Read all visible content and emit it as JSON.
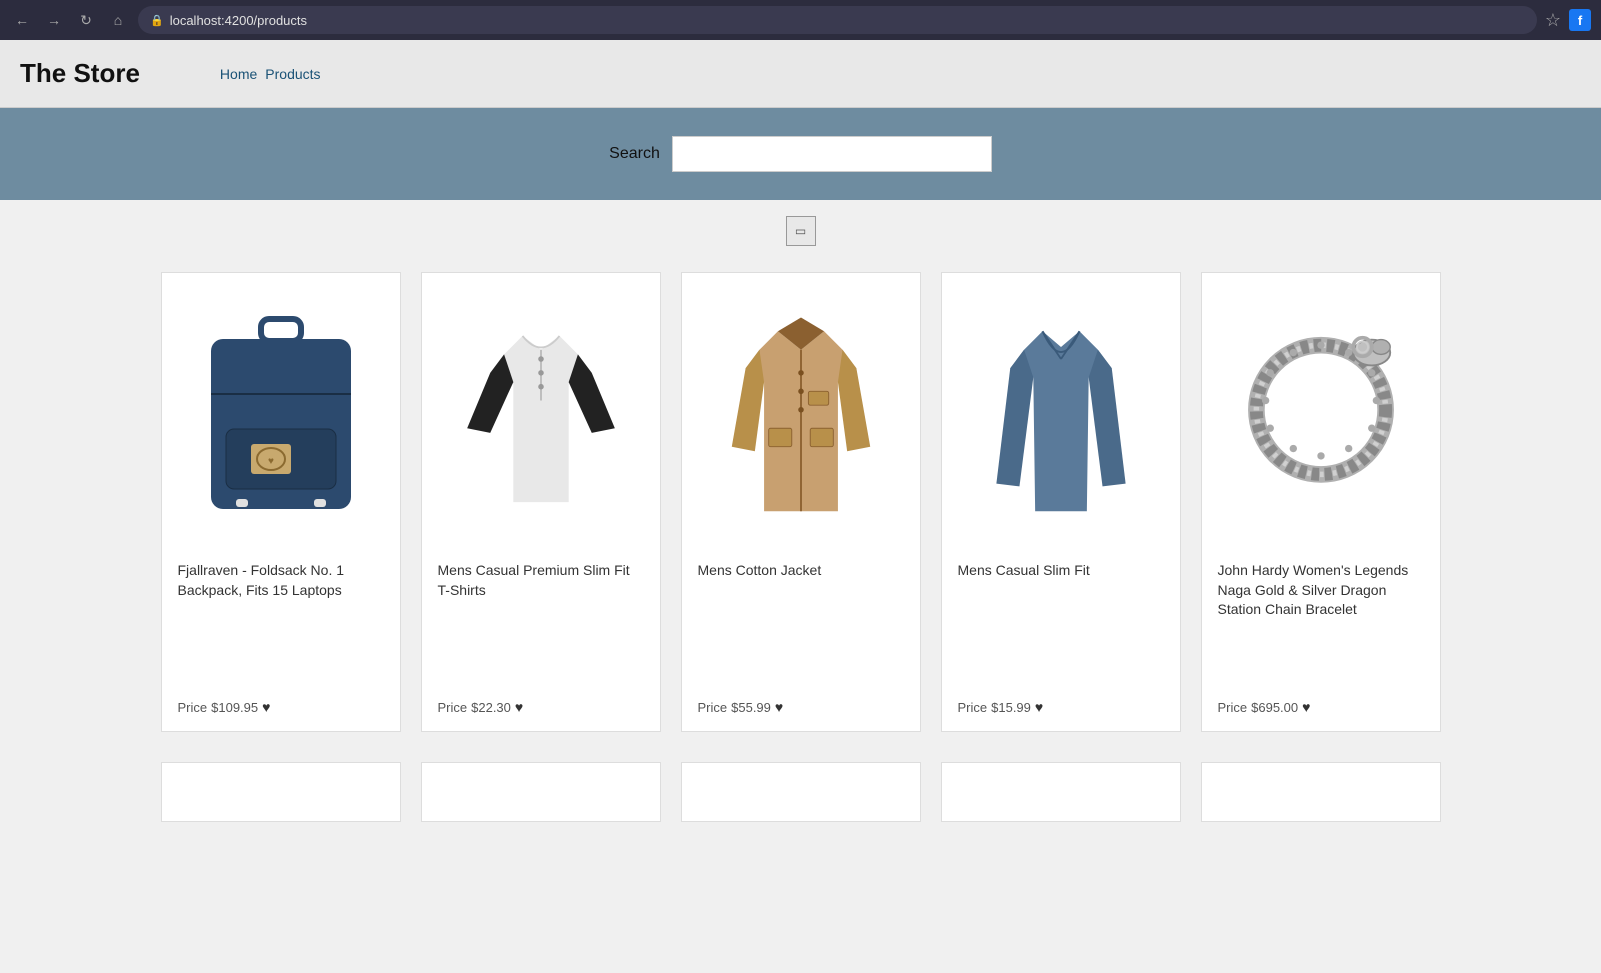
{
  "browser": {
    "url": "localhost:4200/products",
    "back_title": "←",
    "forward_title": "→",
    "reload_title": "↻",
    "home_title": "⌂",
    "star_title": "☆",
    "fb_label": "f"
  },
  "navbar": {
    "brand": "The Store",
    "links": [
      {
        "label": "Home",
        "href": "#"
      },
      {
        "label": "Products",
        "href": "#"
      }
    ]
  },
  "search": {
    "label": "Search",
    "placeholder": ""
  },
  "filter": {
    "icon": "⊞"
  },
  "products": [
    {
      "id": 1,
      "title": "Fjallraven - Foldsack No. 1 Backpack, Fits 15 Laptops",
      "price": "$109.95",
      "color_main": "#2c4a6e",
      "color_accent": "#c8a96e",
      "type": "backpack"
    },
    {
      "id": 2,
      "title": "Mens Casual Premium Slim Fit T-Shirts",
      "price": "$22.30",
      "color_main": "#e8e8e8",
      "color_sleeve": "#222",
      "type": "tshirt"
    },
    {
      "id": 3,
      "title": "Mens Cotton Jacket",
      "price": "$55.99",
      "color_main": "#c8a96e",
      "type": "jacket"
    },
    {
      "id": 4,
      "title": "Mens Casual Slim Fit",
      "price": "$15.99",
      "color_main": "#5a7a9a",
      "type": "longsleeve"
    },
    {
      "id": 5,
      "title": "John Hardy Women's Legends Naga Gold & Silver Dragon Station Chain Bracelet",
      "price": "$695.00",
      "color_main": "#aaaaaa",
      "type": "bracelet"
    }
  ]
}
